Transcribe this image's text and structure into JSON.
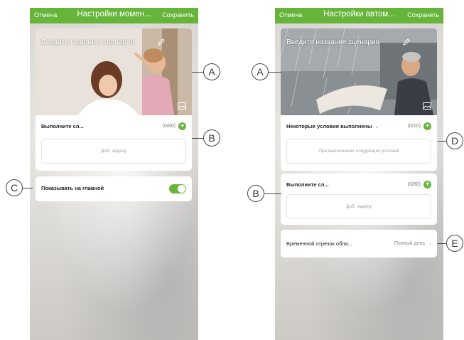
{
  "screen1": {
    "nav": {
      "cancel": "Отмена",
      "title": "Настройки момен...",
      "save": "Сохранить"
    },
    "scene_name_placeholder": "Введите название сценария",
    "tasks": {
      "label": "Выполните сл...",
      "count": "(0/80)",
      "add_task": "Доб. задачу"
    },
    "show_on_home": {
      "label": "Показывать на главной",
      "enabled": true
    }
  },
  "screen2": {
    "nav": {
      "cancel": "Отмена",
      "title": "Настройки автом...",
      "save": "Сохранить"
    },
    "scene_name_placeholder": "Введите название сценария",
    "conditions": {
      "label": "Некоторые условия выполнены",
      "count": "(0/10)",
      "hint": "При выполнении следующих условий"
    },
    "tasks": {
      "label": "Выполните сл...",
      "count": "(0/80)",
      "add_task": "Доб. задачу"
    },
    "time_period": {
      "label": "Временной отрезок обла...",
      "value": "Полный день"
    }
  },
  "callouts": {
    "a1": "A",
    "b1": "B",
    "c1": "C",
    "a2": "A",
    "b2": "B",
    "d2": "D",
    "e2": "E"
  },
  "colors": {
    "accent": "#67b43a"
  }
}
